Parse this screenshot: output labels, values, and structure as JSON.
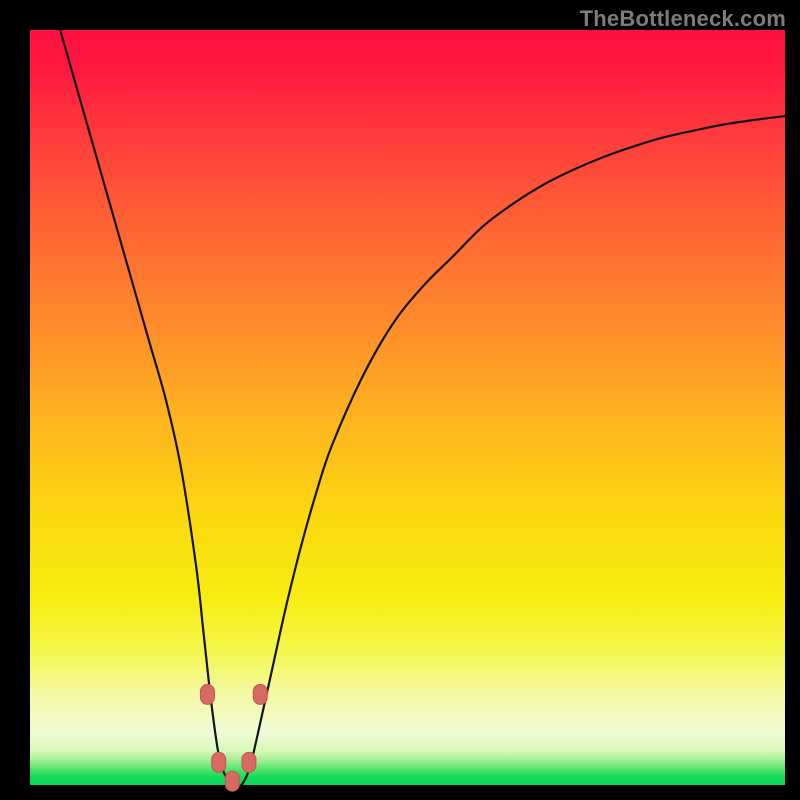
{
  "watermark": "TheBottleneck.com",
  "chart_data": {
    "type": "line",
    "title": "",
    "xlabel": "",
    "ylabel": "",
    "xlim": [
      0,
      100
    ],
    "ylim": [
      0,
      100
    ],
    "grid": false,
    "legend": false,
    "series": [
      {
        "name": "bottleneck-curve",
        "x": [
          4,
          6,
          8,
          10,
          12,
          14,
          16,
          18,
          20,
          22,
          23,
          24,
          25,
          26,
          27,
          28,
          29,
          30,
          32,
          34,
          36,
          38,
          40,
          44,
          48,
          52,
          56,
          60,
          64,
          68,
          72,
          76,
          80,
          84,
          88,
          92,
          96,
          100
        ],
        "values": [
          100,
          93,
          86,
          79,
          72,
          65,
          58,
          51,
          42,
          29,
          20,
          11,
          4,
          1,
          0,
          0,
          2,
          6,
          15,
          24,
          32,
          39,
          45,
          54,
          61,
          66,
          70,
          74,
          77,
          79.5,
          81.5,
          83.2,
          84.6,
          85.8,
          86.7,
          87.5,
          88.1,
          88.6
        ]
      }
    ],
    "markers": [
      {
        "x": 23.5,
        "y": 12
      },
      {
        "x": 30.5,
        "y": 12
      },
      {
        "x": 25.0,
        "y": 3
      },
      {
        "x": 26.8,
        "y": 0.5
      },
      {
        "x": 29.0,
        "y": 3
      }
    ],
    "background_gradient": {
      "top": "#ff103f",
      "mid1": "#ff8f2b",
      "mid2": "#f7ed10",
      "bottom_band": "#08d658"
    }
  }
}
